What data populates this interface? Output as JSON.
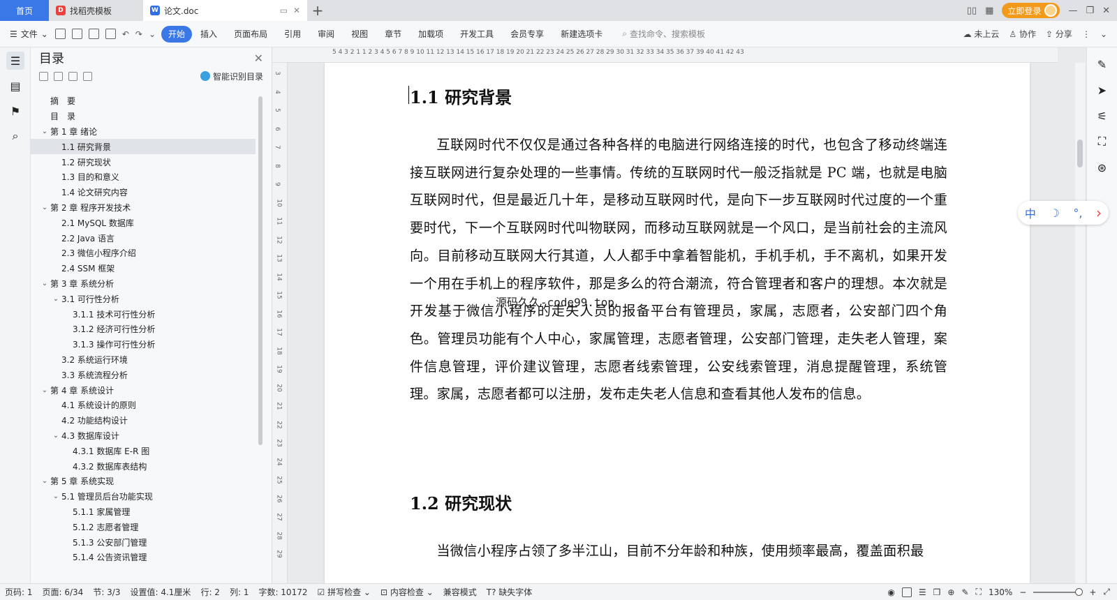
{
  "tabs": {
    "home": "首页",
    "template_tab": "找稻壳模板",
    "doc_tab": "论文.doc",
    "login": "立即登录"
  },
  "ribbon": {
    "file": "文件",
    "tabs": [
      "开始",
      "插入",
      "页面布局",
      "引用",
      "审阅",
      "视图",
      "章节",
      "加载项",
      "开发工具",
      "会员专享",
      "新建选项卡"
    ],
    "search_placeholder": "查找命令、搜索模板",
    "cloud": "未上云",
    "collab": "协作",
    "share": "分享"
  },
  "toc": {
    "title": "目录",
    "smart": "智能识别目录",
    "items": [
      {
        "label": "摘　要",
        "level": 1,
        "chev": ""
      },
      {
        "label": "目　录",
        "level": 1,
        "chev": ""
      },
      {
        "label": "第 1 章  绪论",
        "level": 1,
        "chev": "v"
      },
      {
        "label": "1.1  研究背景",
        "level": 2,
        "chev": "",
        "selected": true
      },
      {
        "label": "1.2  研究现状",
        "level": 2,
        "chev": ""
      },
      {
        "label": "1.3  目的和意义",
        "level": 2,
        "chev": ""
      },
      {
        "label": "1.4  论文研究内容",
        "level": 2,
        "chev": ""
      },
      {
        "label": "第 2 章  程序开发技术",
        "level": 1,
        "chev": "v"
      },
      {
        "label": "2.1 MySQL 数据库",
        "level": 2,
        "chev": ""
      },
      {
        "label": "2.2 Java 语言",
        "level": 2,
        "chev": ""
      },
      {
        "label": "2.3  微信小程序介绍",
        "level": 2,
        "chev": ""
      },
      {
        "label": "2.4 SSM 框架",
        "level": 2,
        "chev": ""
      },
      {
        "label": "第 3 章  系统分析",
        "level": 1,
        "chev": "v"
      },
      {
        "label": "3.1 可行性分析",
        "level": 2,
        "chev": "v"
      },
      {
        "label": "3.1.1 技术可行性分析",
        "level": 3,
        "chev": ""
      },
      {
        "label": "3.1.2 经济可行性分析",
        "level": 3,
        "chev": ""
      },
      {
        "label": "3.1.3 操作可行性分析",
        "level": 3,
        "chev": ""
      },
      {
        "label": "3.2 系统运行环境",
        "level": 2,
        "chev": ""
      },
      {
        "label": "3.3 系统流程分析",
        "level": 2,
        "chev": ""
      },
      {
        "label": "第 4 章  系统设计",
        "level": 1,
        "chev": "v"
      },
      {
        "label": "4.1  系统设计的原则",
        "level": 2,
        "chev": ""
      },
      {
        "label": "4.2  功能结构设计",
        "level": 2,
        "chev": ""
      },
      {
        "label": "4.3  数据库设计",
        "level": 2,
        "chev": "v"
      },
      {
        "label": "4.3.1  数据库 E-R 图",
        "level": 3,
        "chev": ""
      },
      {
        "label": "4.3.2  数据库表结构",
        "level": 3,
        "chev": ""
      },
      {
        "label": "第 5 章  系统实现",
        "level": 1,
        "chev": "v"
      },
      {
        "label": "5.1 管理员后台功能实现",
        "level": 2,
        "chev": "v"
      },
      {
        "label": "5.1.1  家属管理",
        "level": 3,
        "chev": ""
      },
      {
        "label": "5.1.2  志愿者管理",
        "level": 3,
        "chev": ""
      },
      {
        "label": "5.1.3  公安部门管理",
        "level": 3,
        "chev": ""
      },
      {
        "label": "5.1.4  公告资讯管理",
        "level": 3,
        "chev": ""
      }
    ]
  },
  "ruler": {
    "h": "5   4   3   2   1       1   2   3   4   5   6   7   8   9  10  11  12  13  14  15  16  17  18  19  20  21  22  23  24  25  26  27  28  29  30  31  32  33  34  35  36  37      39  40  41  42  43",
    "v": [
      "3",
      "4",
      "5",
      "6",
      "7",
      "8",
      "9",
      "10",
      "11",
      "12",
      "13",
      "14",
      "15",
      "16",
      "17",
      "18",
      "19",
      "20",
      "21",
      "22",
      "23",
      "24",
      "25",
      "26",
      "27",
      "28",
      "29"
    ]
  },
  "doc": {
    "h1_1": "1.1  研究背景",
    "p1": "互联网时代不仅仅是通过各种各样的电脑进行网络连接的时代，也包含了移动终端连接互联网进行复杂处理的一些事情。传统的互联网时代一般泛指就是 PC 端，也就是电脑互联网时代，但是最近几十年，是移动互联网时代，是向下一步互联网时代过度的一个重要时代，下一个互联网时代叫物联网，而移动互联网就是一个风口，是当前社会的主流风向。目前移动互联网大行其道，人人都手中拿着智能机，手机手机，手不离机，如果开发一个用在手机上的程序软件，那是多么的符合潮流，符合管理者和客户的理想。本次就是开发基于微信小程序的走失人员的报备平台有管理员，家属，志愿者，公安部门四个角色。管理员功能有个人中心，家属管理，志愿者管理，公安部门管理，走失老人管理，案件信息管理，评价建议管理，志愿者线索管理，公安线索管理，消息提醒管理，系统管理。家属，志愿者都可以注册，发布走失老人信息和查看其他人发布的信息。",
    "watermark": "源码久久-code99.top",
    "h1_2": "1.2  研究现状",
    "p2": "当微信小程序占领了多半江山，目前不分年龄和种族，使用频率最高，覆盖面积最"
  },
  "ime": {
    "zh": "中",
    "moon": "☽",
    "dot": "°,",
    "arrow": "›"
  },
  "status": {
    "page_code": "页码: 1",
    "page": "页面: 6/34",
    "section": "节: 3/3",
    "setting": "设置值: 4.1厘米",
    "row": "行: 2",
    "col": "列: 1",
    "words": "字数: 10172",
    "spell": "拼写检查",
    "content_check": "内容检查",
    "compat": "兼容模式",
    "missing_font": "缺失字体",
    "zoom": "130%"
  },
  "colors": {
    "accent": "#3b78e7",
    "login": "#f39a1b"
  }
}
